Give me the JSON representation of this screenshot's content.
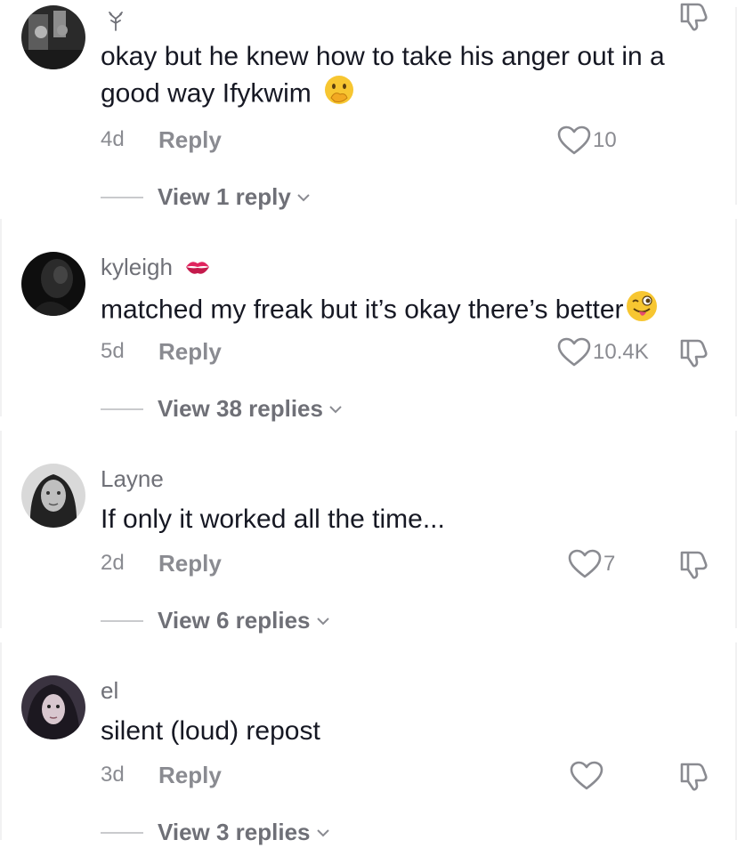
{
  "comments": [
    {
      "username": "",
      "username_emoji": "seedling-glyph-icon",
      "text": "okay but he knew how to take his anger out in a good way Ifykwim",
      "text_emoji": "face-with-hand-over-mouth-emoji",
      "age": "4d",
      "reply_label": "Reply",
      "likes": "10",
      "view_replies": "View 1 reply"
    },
    {
      "username": "kyleigh",
      "username_emoji": "kiss-mark-emoji",
      "text": "matched my freak but it’s okay there’s better",
      "text_emoji": "winking-face-with-tongue-emoji",
      "age": "5d",
      "reply_label": "Reply",
      "likes": "10.4K",
      "view_replies": "View 38 replies"
    },
    {
      "username": "Layne",
      "text": "If only it worked all the time...",
      "age": "2d",
      "reply_label": "Reply",
      "likes": "7",
      "view_replies": "View 6 replies"
    },
    {
      "username": "el",
      "text": "silent (loud) repost",
      "age": "3d",
      "reply_label": "Reply",
      "likes": "",
      "view_replies": "View 3 replies"
    }
  ],
  "colors": {
    "text_primary": "#161823",
    "text_secondary": "#8a8b91",
    "kiss_red": "#e0245e",
    "emoji_yellow": "#f7c631"
  }
}
